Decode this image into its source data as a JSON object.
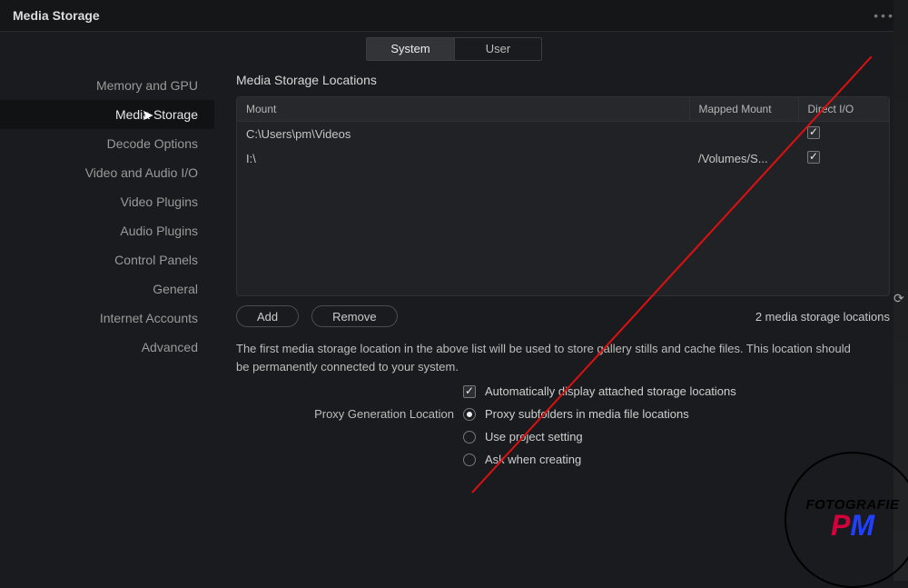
{
  "window": {
    "title": "Media Storage",
    "more": "•••"
  },
  "tabs": {
    "system": "System",
    "user": "User"
  },
  "sidebar": {
    "items": [
      {
        "label": "Memory and GPU"
      },
      {
        "label": "Media Storage"
      },
      {
        "label": "Decode Options"
      },
      {
        "label": "Video and Audio I/O"
      },
      {
        "label": "Video Plugins"
      },
      {
        "label": "Audio Plugins"
      },
      {
        "label": "Control Panels"
      },
      {
        "label": "General"
      },
      {
        "label": "Internet Accounts"
      },
      {
        "label": "Advanced"
      }
    ]
  },
  "section": {
    "title": "Media Storage Locations"
  },
  "table": {
    "headers": {
      "mount": "Mount",
      "mapped": "Mapped Mount",
      "direct": "Direct I/O"
    },
    "rows": [
      {
        "mount": "C:\\Users\\pm\\Videos",
        "mapped": "",
        "direct": true
      },
      {
        "mount": "I:\\",
        "mapped": "/Volumes/S...",
        "direct": true
      }
    ]
  },
  "buttons": {
    "add": "Add",
    "remove": "Remove"
  },
  "summary": "2 media storage locations",
  "help": "The first media storage location in the above list will be used to store gallery stills and cache files. This location should be permanently connected to your system.",
  "auto_display": "Automatically display attached storage locations",
  "proxy": {
    "label": "Proxy Generation Location",
    "opt_subfolders": "Proxy subfolders in media file locations",
    "opt_project": "Use project setting",
    "opt_ask": "Ask when creating"
  },
  "watermark": {
    "line1": "FOTOGRAFIE",
    "p": "P",
    "m": "M"
  }
}
